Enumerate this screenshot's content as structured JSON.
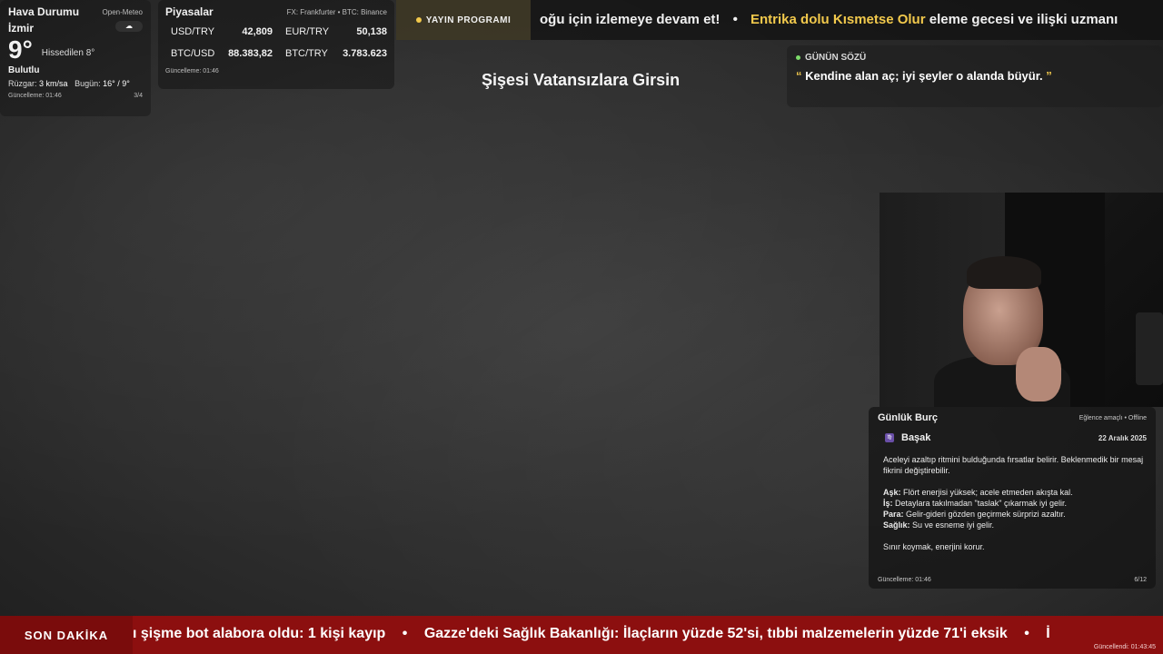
{
  "weather": {
    "title": "Hava Durumu",
    "source": "Open-Meteo",
    "city": "İzmir",
    "icon": "cloud-icon",
    "temperature": "9°",
    "feels_like": "Hissedilen 8°",
    "condition": "Bulutlu",
    "wind_label": "Rüzgar:",
    "wind_value": "3 km/sa",
    "today_label": "Bugün:",
    "today_value": "16° / 9°",
    "updated": "Güncelleme: 01:46",
    "page": "3/4"
  },
  "markets": {
    "title": "Piyasalar",
    "source": "FX: Frankfurter • BTC: Binance",
    "rates": [
      {
        "pair": "USD/TRY",
        "value": "42,809"
      },
      {
        "pair": "EUR/TRY",
        "value": "50,138"
      },
      {
        "pair": "BTC/USD",
        "value": "88.383,82"
      },
      {
        "pair": "BTC/TRY",
        "value": "3.783.623"
      }
    ],
    "updated": "Güncelleme: 01:46"
  },
  "top_ticker": {
    "schedule_label": "YAYIN PROGRAMI",
    "text_before": "oğu için izlemeye devam et!",
    "separator": "•",
    "highlight": "Entrika dolu Kısmetse Olur",
    "text_after": " eleme gecesi ve ilişki uzmanı"
  },
  "stream_title": "Şişesi Vatansızlara Girsin",
  "quote": {
    "header": "GÜNÜN SÖZÜ",
    "open_mark": "“",
    "text": " Kendine alan aç; iyi şeyler o alanda büyür. ",
    "close_mark": "”"
  },
  "horoscope": {
    "title": "Günlük Burç",
    "note": "Eğlence amaçlı • Offline",
    "sign": "Başak",
    "sign_badge": "♍",
    "date": "22 Aralık 2025",
    "intro": "Aceleyi azaltıp ritmini bulduğunda fırsatlar belirir. Beklenmedik bir mesaj fikrini değiştirebilir.",
    "love_label": "Aşk:",
    "love": " Flört enerjisi yüksek; acele etmeden akışta kal.",
    "work_label": "İş:",
    "work": " Detaylara takılmadan \"taslak\" çıkarmak iyi gelir.",
    "money_label": "Para:",
    "money": " Gelir-gideri gözden geçirmek sürprizi azaltır.",
    "health_label": "Sağlık:",
    "health": " Su ve esneme iyi gelir.",
    "closing": "Sınır koymak, enerjini korur.",
    "updated": "Güncelleme: 01:46",
    "page": "6/12"
  },
  "breaking": {
    "label": "SON DAKİKA",
    "item1": "ı şişme bot alabora oldu: 1 kişi kayıp",
    "separator": "•",
    "item2": "Gazze'deki Sağlık Bakanlığı: İlaçların yüzde 52'si, tıbbi malzemelerin yüzde 71'i eksik",
    "item3": "İ",
    "updated": "Güncellendi: 01:43:45"
  }
}
